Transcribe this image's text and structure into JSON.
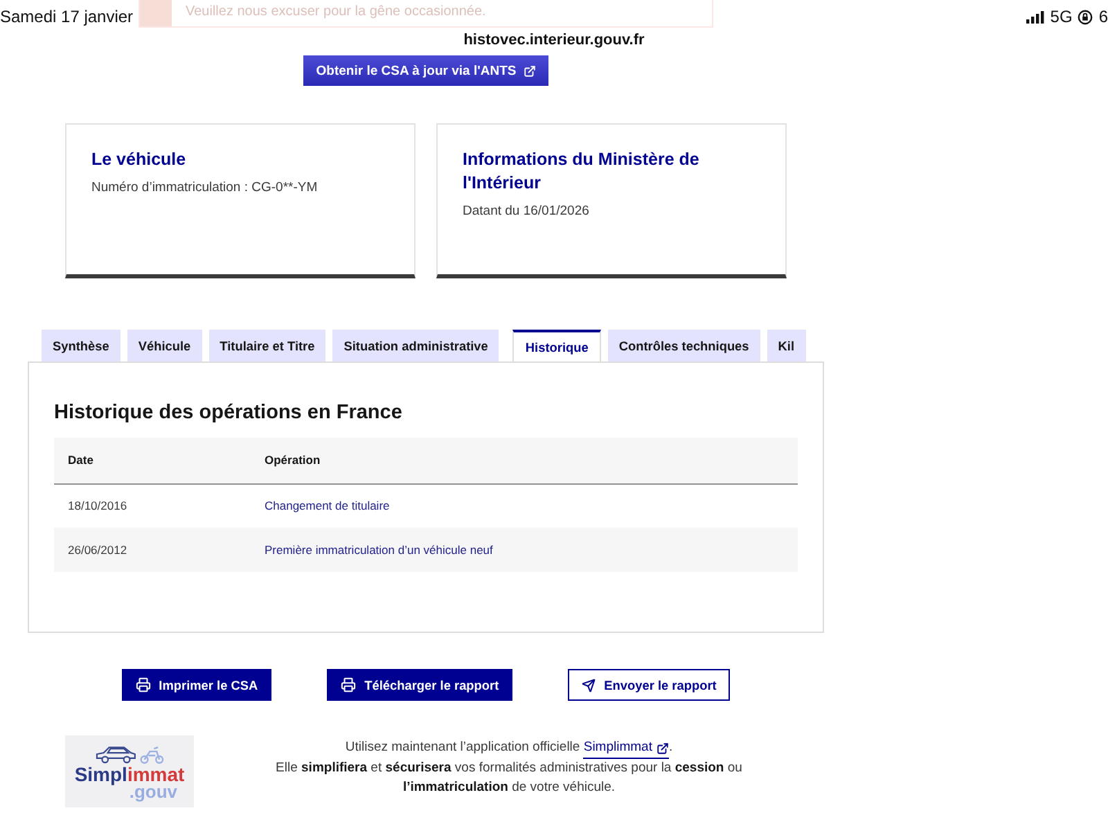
{
  "status_bar": {
    "date": "Samedi 17 janvier",
    "network": "5G",
    "battery": "6"
  },
  "address_bar": {
    "url": "histovec.interieur.gouv.fr"
  },
  "alert": {
    "text": "Veuillez nous excuser pour la gêne occasionnée."
  },
  "ants_button": {
    "label": "Obtenir le CSA à jour via l'ANTS"
  },
  "cards": [
    {
      "title": "Le véhicule",
      "text": "Numéro d’immatriculation : CG-0**-YM"
    },
    {
      "title": "Informations du Ministère de l'Intérieur",
      "text": "Datant du 16/01/2026"
    }
  ],
  "tabs": [
    {
      "label": "Synthèse",
      "selected": false
    },
    {
      "label": "Véhicule",
      "selected": false
    },
    {
      "label": "Titulaire et Titre",
      "selected": false
    },
    {
      "label": "Situation administrative",
      "selected": false
    },
    {
      "label": "Historique",
      "selected": true
    },
    {
      "label": "Contrôles techniques",
      "selected": false
    },
    {
      "label": "Kil",
      "selected": false
    }
  ],
  "history": {
    "title": "Historique des opérations en France",
    "columns": [
      "Date",
      "Opération"
    ],
    "rows": [
      {
        "date": "18/10/2016",
        "operation": "Changement de titulaire"
      },
      {
        "date": "26/06/2012",
        "operation": "Première immatriculation d’un véhicule neuf"
      }
    ]
  },
  "actions": [
    {
      "kind": "primary",
      "label": "Imprimer le CSA"
    },
    {
      "kind": "primary",
      "label": "Télécharger le rapport"
    },
    {
      "kind": "secondary",
      "label": "Envoyer le rapport"
    }
  ],
  "footer": {
    "logo": {
      "name_start": "Simpl",
      "name_end": "immat",
      "suffix": ".gouv"
    },
    "intro": "Utilisez maintenant l’application officielle",
    "link": "Simplimmat",
    "intro_end": ".",
    "body": "Elle **simplifiera** et **sécurisera** vos formalités administratives pour la **cession** ou **l’immatriculation** de votre véhicule."
  }
}
